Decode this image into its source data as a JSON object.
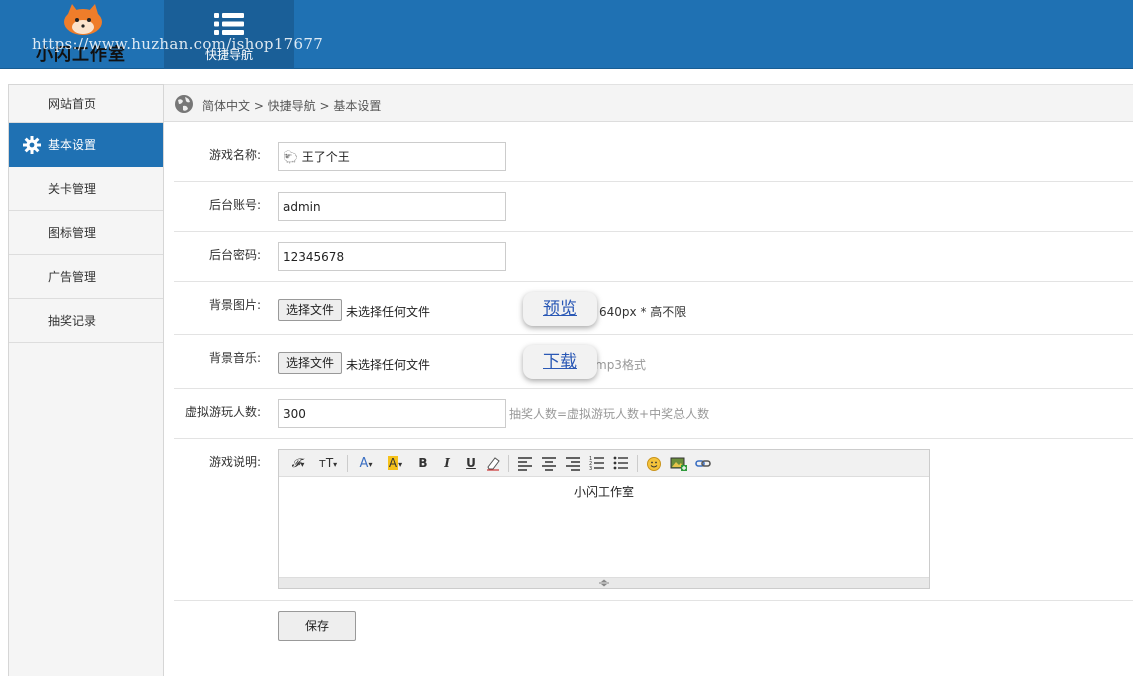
{
  "header": {
    "logo_text": "小闪工作室",
    "watermark": "https://www.huzhan.com/ishop17677",
    "quicknav_label": "快捷导航"
  },
  "sidebar": {
    "items": [
      {
        "label": "网站首页"
      },
      {
        "label": "基本设置"
      },
      {
        "label": "关卡管理"
      },
      {
        "label": "图标管理"
      },
      {
        "label": "广告管理"
      },
      {
        "label": "抽奖记录"
      }
    ],
    "active_index": 1
  },
  "breadcrumb": {
    "text": "简体中文 > 快捷导航 > 基本设置"
  },
  "form": {
    "game_name": {
      "label": "游戏名称:",
      "value": "🐑 王了个王"
    },
    "admin_account": {
      "label": "后台账号:",
      "value": "admin"
    },
    "admin_password": {
      "label": "后台密码:",
      "value": "12345678"
    },
    "background_image": {
      "label": "背景图片:",
      "button": "选择文件",
      "file_text": "未选择任何文件",
      "preview": "预览",
      "hint": "640px * 高不限"
    },
    "background_music": {
      "label": "背景音乐:",
      "button": "选择文件",
      "file_text": "未选择任何文件",
      "download": "下载",
      "hint": "mp3格式"
    },
    "virtual_players": {
      "label": "虚拟游玩人数:",
      "value": "300",
      "hint": "抽奖人数=虚拟游玩人数+中奖总人数"
    },
    "description": {
      "label": "游戏说明:",
      "content": "小闪工作室"
    },
    "save_button": "保存"
  },
  "editor_toolbar": {
    "font_family": "𝓕",
    "font_size": "тT",
    "font_color": "A",
    "bg_color": "A",
    "bold": "B",
    "italic": "I",
    "underline": "U"
  },
  "colors": {
    "header_bg": "#1f71b3",
    "active_bg": "#1f71b3",
    "link": "#2a58b5",
    "hint": "#999999"
  }
}
